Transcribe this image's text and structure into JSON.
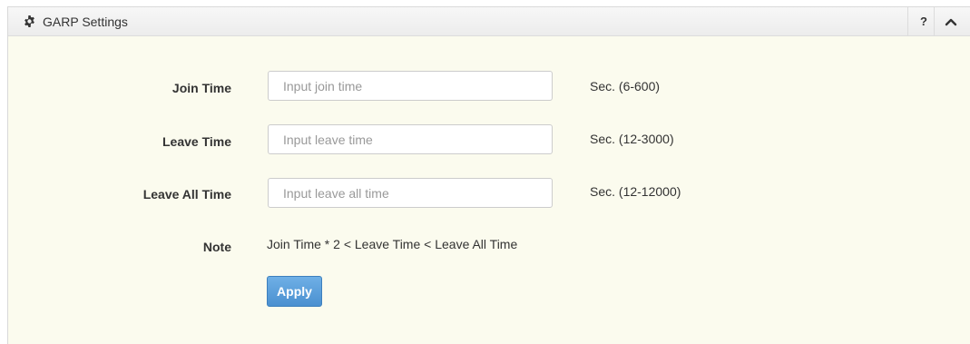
{
  "panel": {
    "title": "GARP Settings",
    "title_icon": "gear-icon",
    "help_label": "?",
    "collapse_icon": "chevron-up-icon"
  },
  "form": {
    "join_time": {
      "label": "Join Time",
      "value": "",
      "placeholder": "Input join time",
      "range": "Sec. (6-600)"
    },
    "leave_time": {
      "label": "Leave Time",
      "value": "",
      "placeholder": "Input leave time",
      "range": "Sec. (12-3000)"
    },
    "leave_all_time": {
      "label": "Leave All Time",
      "value": "",
      "placeholder": "Input leave all time",
      "range": "Sec. (12-12000)"
    },
    "note": {
      "label": "Note",
      "text": "Join Time * 2 < Leave Time < Leave All Time"
    },
    "apply_label": "Apply"
  },
  "colors": {
    "panel_background": "#fbfbee",
    "apply_button": "#4a90d0"
  }
}
